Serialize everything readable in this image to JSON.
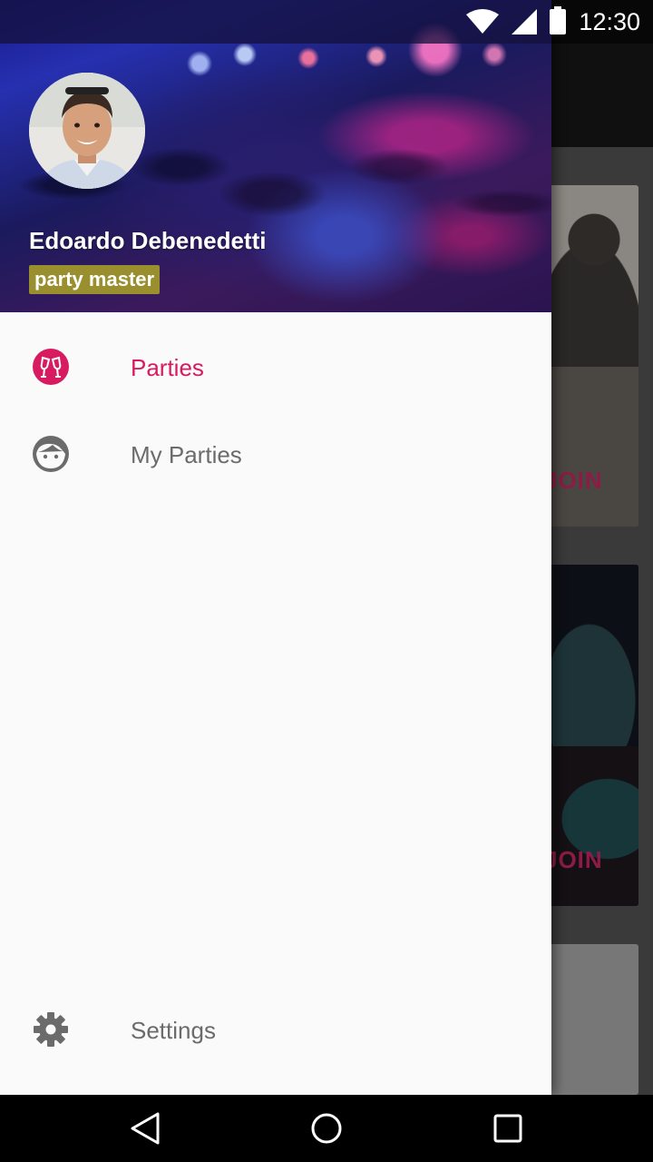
{
  "status_bar": {
    "time": "12:30",
    "icons": [
      "wifi-icon",
      "signal-icon",
      "battery-icon"
    ]
  },
  "drawer": {
    "user": {
      "name": "Edoardo Debenedetti",
      "badge": "party master"
    },
    "menu": [
      {
        "label": "Parties",
        "icon": "cheers-glasses-icon",
        "selected": true
      },
      {
        "label": "My Parties",
        "icon": "face-icon",
        "selected": false
      }
    ],
    "settings": {
      "label": "Settings",
      "icon": "gear-icon"
    }
  },
  "background": {
    "cards": [
      {
        "action_label": "JOIN"
      },
      {
        "action_label": "JOIN"
      }
    ]
  },
  "nav_bar": {
    "buttons": [
      "back-icon",
      "home-icon",
      "recents-icon"
    ]
  },
  "colors": {
    "accent": "#d81b60",
    "badge": "#9a8f2e",
    "menu_text": "#6b6b6b",
    "drawer_bg": "#fafafa"
  }
}
